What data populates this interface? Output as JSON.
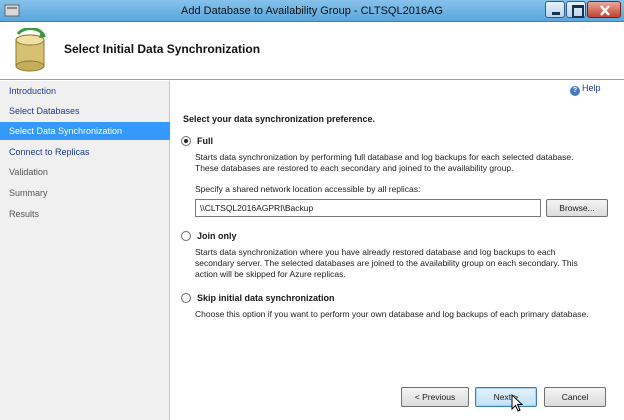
{
  "window": {
    "title": "Add Database to Availability Group - CLTSQL2016AG"
  },
  "header": {
    "title": "Select Initial Data Synchronization"
  },
  "nav": {
    "items": [
      {
        "label": "Introduction",
        "state": "done"
      },
      {
        "label": "Select Databases",
        "state": "done"
      },
      {
        "label": "Select Data Synchronization",
        "state": "active"
      },
      {
        "label": "Connect to Replicas",
        "state": "done"
      },
      {
        "label": "Validation",
        "state": "future"
      },
      {
        "label": "Summary",
        "state": "future"
      },
      {
        "label": "Results",
        "state": "future"
      }
    ]
  },
  "main": {
    "help_label": "Help",
    "prompt": "Select your data synchronization preference.",
    "options": {
      "full": {
        "label": "Full",
        "selected": true,
        "description": "Starts data synchronization by performing full database and log backups for each selected database. These databases are restored to each secondary and joined to the availability group.",
        "share_label": "Specify a shared network location accessible by all replicas:",
        "share_value": "\\\\CLTSQL2016AGPRI\\Backup",
        "browse_label": "Browse..."
      },
      "join_only": {
        "label": "Join only",
        "selected": false,
        "description": "Starts data synchronization where you have already restored database and log backups to each secondary server. The selected databases are joined to the availability group on each secondary. This action will be skipped for Azure replicas."
      },
      "skip": {
        "label": "Skip initial data synchronization",
        "selected": false,
        "description": "Choose this option if you want to perform your own database and log backups of each primary database."
      }
    }
  },
  "footer": {
    "previous_label": "< Previous",
    "next_label": "Next >",
    "cancel_label": "Cancel"
  },
  "colors": {
    "nav_active_bg": "#3399ff",
    "nav_link": "#1f3a93",
    "titlebar": "#5aa7de"
  }
}
